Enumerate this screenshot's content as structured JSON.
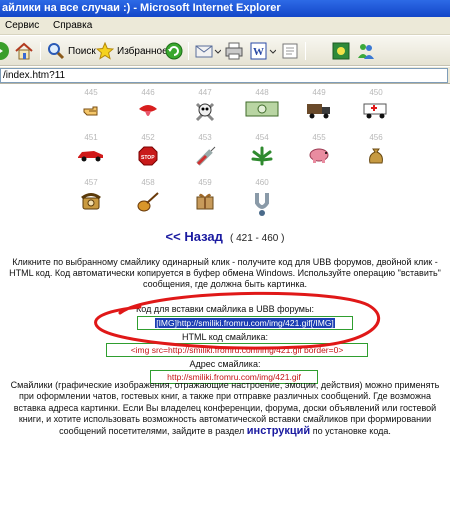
{
  "window": {
    "title": "айлики на все случаи :) - Microsoft Internet Explorer"
  },
  "menu": {
    "items": [
      "Сервис",
      "Справка"
    ]
  },
  "toolbar": {
    "search_label": "Поиск",
    "favorites_label": "Избранное"
  },
  "address": {
    "value": "/index.htm?11"
  },
  "smilies": [
    {
      "num": "445",
      "icon": "hand-pointing-icon"
    },
    {
      "num": "446",
      "icon": "lips-tongue-icon"
    },
    {
      "num": "447",
      "icon": "skull-crossbones-icon"
    },
    {
      "num": "448",
      "icon": "banknote-icon"
    },
    {
      "num": "449",
      "icon": "truck-icon"
    },
    {
      "num": "450",
      "icon": "ambulance-icon"
    },
    {
      "num": "451",
      "icon": "red-car-icon"
    },
    {
      "num": "452",
      "icon": "stop-sign-icon"
    },
    {
      "num": "453",
      "icon": "syringe-icon"
    },
    {
      "num": "454",
      "icon": "cannabis-leaf-icon"
    },
    {
      "num": "455",
      "icon": "piggy-bank-icon"
    },
    {
      "num": "456",
      "icon": "money-bag-icon"
    },
    {
      "num": "457",
      "icon": "telephone-icon"
    },
    {
      "num": "458",
      "icon": "guitar-icon"
    },
    {
      "num": "459",
      "icon": "gift-box-icon"
    },
    {
      "num": "460",
      "icon": "magnet-icon"
    }
  ],
  "nav": {
    "back_label": "<< Назад",
    "range": "( 421 - 460 )"
  },
  "description": "Кликните по выбранному смайлику одинарный клик - получите код для UBB форумов, двойной клик - HTML код. Код автоматически копируется в буфер обмена Windows. Используйте операцию \"вставить\" сообщения, где должна быть картинка.",
  "codes": {
    "ubb_label": "Код для вставки смайлика в UBB форумы:",
    "ubb_value": "[IMG]http://smiliki.fromru.com/img/421.gif[/IMG]",
    "html_label": "HTML код смайлика:",
    "html_value": "<img src=http://smiliki.fromru.com/img/421.gif border=0>",
    "addr_label": "Адрес смайлика:",
    "addr_value": "http://smiliki.fromru.com/img/421.gif"
  },
  "info": {
    "text": "Смайлики (графические изображения, отражающие настроение, эмоции, действия) можно применять при оформлении чатов, гостевых книг, а также при отправке различных сообщений. Где возможна вставка адреса картинки. Если Вы владелец конференции, форума, доски объявлений или гостевой книги, и хотите использовать возможность автоматической вставки смайликов при формировании сообщений посетителями, зайдите в раздел",
    "link": "инструкций",
    "tail": "по установке кода."
  },
  "colors": {
    "accent_red": "#e01818",
    "link_blue": "#1a1aa0",
    "selection": "#1c3fb4"
  }
}
